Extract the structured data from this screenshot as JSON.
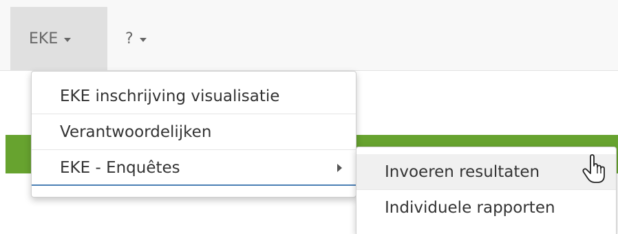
{
  "navbar": {
    "items": [
      {
        "label": "EKE",
        "icon": "caret-down-icon"
      },
      {
        "label": "?",
        "icon": "caret-down-icon"
      }
    ]
  },
  "menu": {
    "items": [
      {
        "label": "EKE inschrijving visualisatie"
      },
      {
        "label": "Verantwoordelijken"
      },
      {
        "label": "EKE - Enquêtes",
        "icon": "caret-right-icon"
      }
    ]
  },
  "submenu": {
    "items": [
      {
        "label": "Invoeren resultaten"
      },
      {
        "label": "Individuele rapporten"
      }
    ]
  },
  "colors": {
    "accent_green": "#67a32f",
    "active_underline": "#4a7fb5"
  }
}
